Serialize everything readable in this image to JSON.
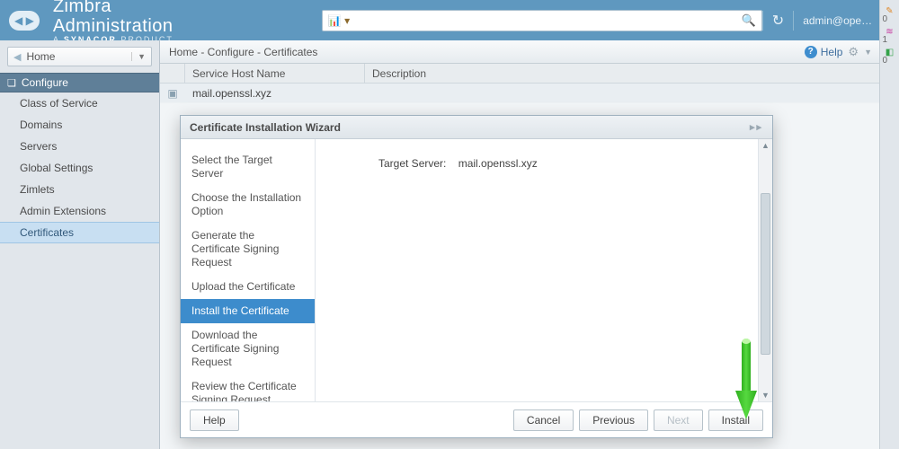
{
  "header": {
    "brand_title": "Zimbra Administration",
    "brand_sub_prefix": "A ",
    "brand_sub_bold": "SYNACOR",
    "brand_sub_suffix": " PRODUCT",
    "search_placeholder": "",
    "account_label": "admin@ope…"
  },
  "sidebar": {
    "home_label": "Home",
    "group_label": "Configure",
    "items": [
      "Class of Service",
      "Domains",
      "Servers",
      "Global Settings",
      "Zimlets",
      "Admin Extensions",
      "Certificates"
    ],
    "selected_index": 6
  },
  "breadcrumb": {
    "text": "Home - Configure - Certificates",
    "help_label": "Help"
  },
  "table": {
    "columns": [
      "",
      "Service Host Name",
      "Description"
    ],
    "rows": [
      {
        "host": "mail.openssl.xyz",
        "desc": ""
      }
    ]
  },
  "iconstrip": {
    "items": [
      {
        "glyph": "✎",
        "color": "#e08a2c",
        "count": "0"
      },
      {
        "glyph": "≋",
        "color": "#c73aa0",
        "count": "1"
      },
      {
        "glyph": "◧",
        "color": "#34a24a",
        "count": "0"
      }
    ]
  },
  "dialog": {
    "title": "Certificate Installation Wizard",
    "steps": [
      "Select the Target Server",
      "Choose the Installation Option",
      "Generate the Certificate Signing Request",
      "Upload the Certificate",
      "Install the Certificate",
      "Download the Certificate Signing Request",
      "Review the Certificate Signing Request"
    ],
    "selected_step": 4,
    "target_label": "Target Server:",
    "target_value": "mail.openssl.xyz",
    "buttons": {
      "help": "Help",
      "cancel": "Cancel",
      "previous": "Previous",
      "next": "Next",
      "install": "Install"
    },
    "next_disabled": true
  }
}
